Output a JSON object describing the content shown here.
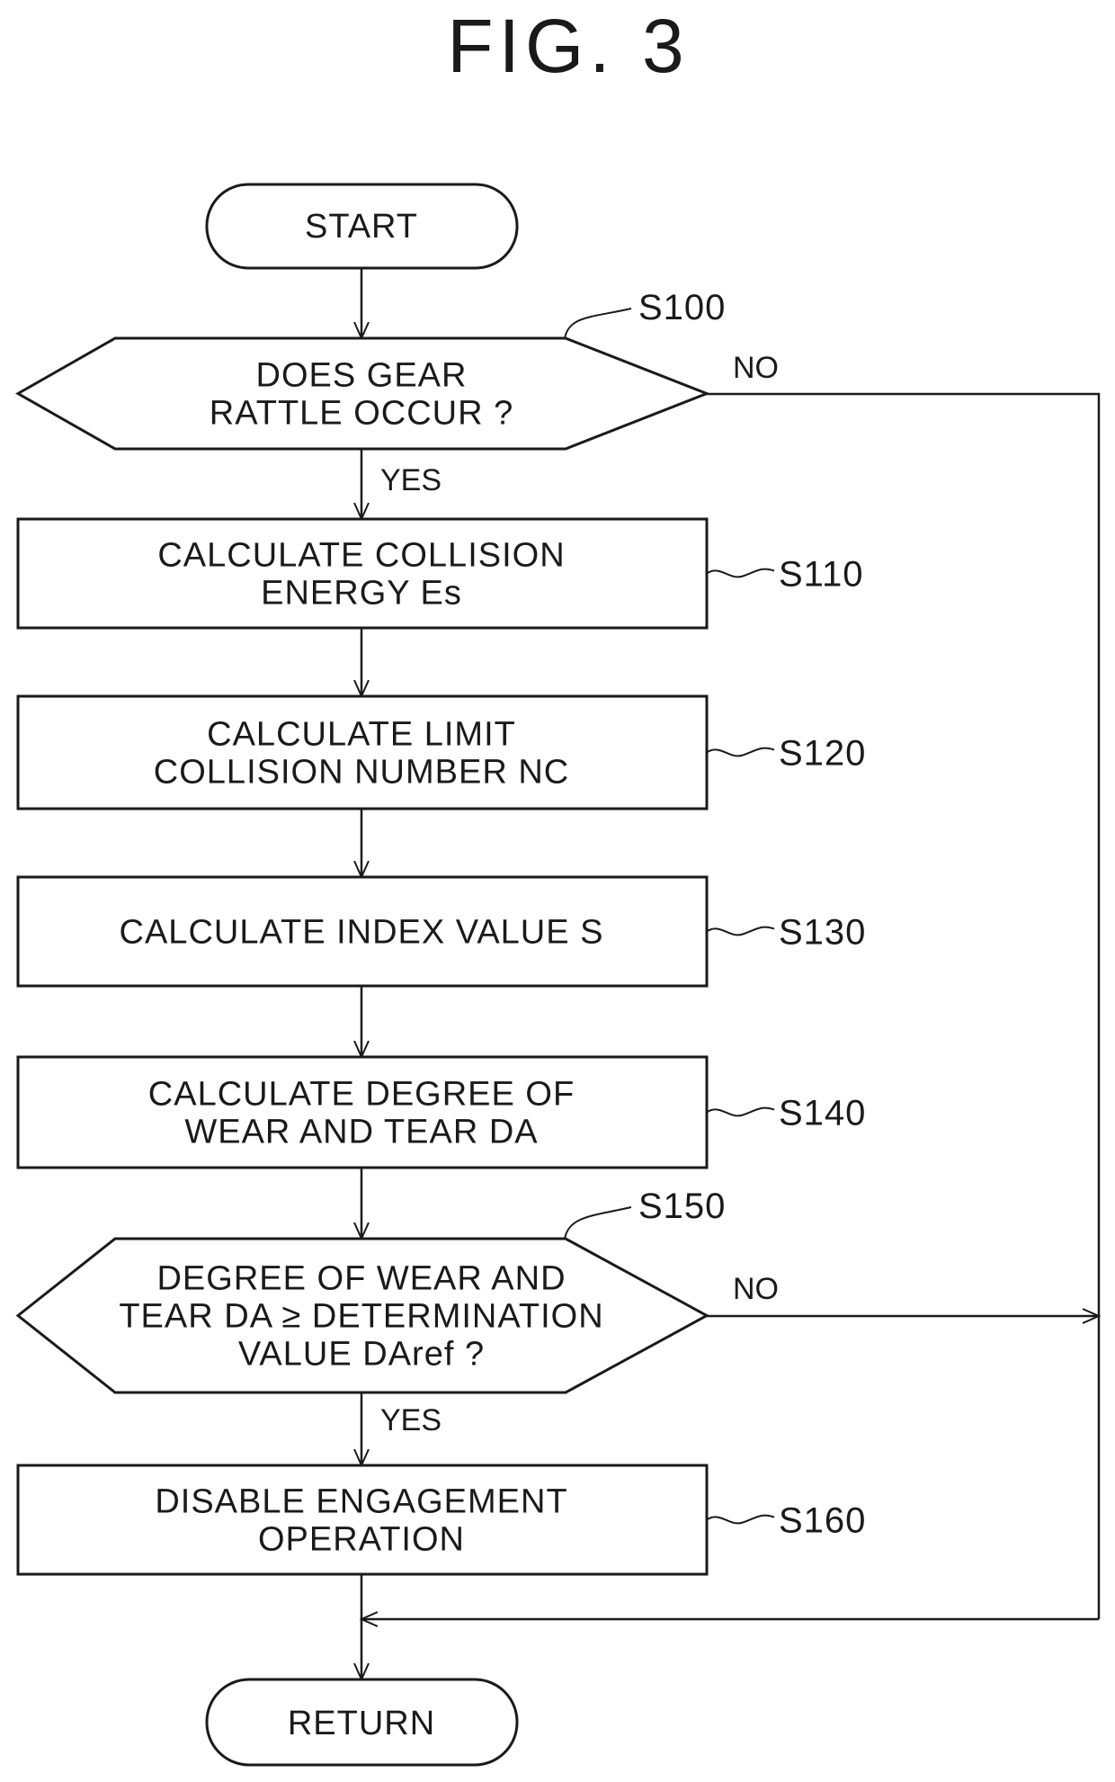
{
  "figure": {
    "title": "FIG. 3"
  },
  "flowchart": {
    "start": {
      "label": "START"
    },
    "end": {
      "label": "RETURN"
    },
    "steps": [
      {
        "id": "S100",
        "type": "decision",
        "lines": [
          "DOES GEAR",
          "RATTLE OCCUR ?"
        ],
        "yes_label": "YES",
        "no_label": "NO"
      },
      {
        "id": "S110",
        "type": "process",
        "lines": [
          "CALCULATE COLLISION",
          "ENERGY Es"
        ]
      },
      {
        "id": "S120",
        "type": "process",
        "lines": [
          "CALCULATE LIMIT",
          "COLLISION NUMBER NC"
        ]
      },
      {
        "id": "S130",
        "type": "process",
        "lines": [
          "CALCULATE INDEX VALUE S"
        ]
      },
      {
        "id": "S140",
        "type": "process",
        "lines": [
          "CALCULATE DEGREE OF",
          "WEAR AND TEAR DA"
        ]
      },
      {
        "id": "S150",
        "type": "decision",
        "lines": [
          "DEGREE OF WEAR AND",
          "TEAR DA ≥ DETERMINATION",
          "VALUE DAref ?"
        ],
        "yes_label": "YES",
        "no_label": "NO"
      },
      {
        "id": "S160",
        "type": "process",
        "lines": [
          "DISABLE ENGAGEMENT",
          "OPERATION"
        ]
      }
    ]
  }
}
